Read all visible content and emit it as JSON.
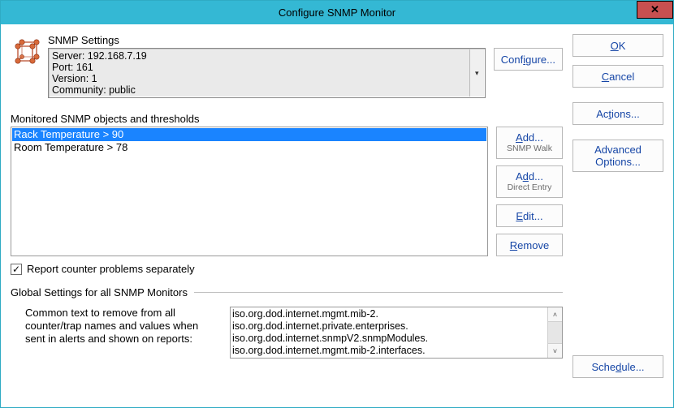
{
  "window": {
    "title": "Configure SNMP Monitor",
    "close_glyph": "✕"
  },
  "snmp": {
    "section_label": "SNMP Settings",
    "server_line": "Server: 192.168.7.19",
    "port_line": "Port: 161",
    "version_line": "Version: 1",
    "community_line": "Community: public",
    "configure_label_pre": "Conf",
    "configure_label_u": "i",
    "configure_label_post": "gure...",
    "dropdown_glyph": "▾"
  },
  "right": {
    "ok_u": "O",
    "ok_post": "K",
    "cancel_u": "C",
    "cancel_post": "ancel",
    "actions_pre": "Ac",
    "actions_u": "t",
    "actions_post": "ions...",
    "advanced_line1": "Advanced",
    "advanced_line2": "Options...",
    "schedule_pre": "Sche",
    "schedule_u": "d",
    "schedule_post": "ule..."
  },
  "monitor": {
    "section_label": "Monitored SNMP objects and thresholds",
    "items": [
      {
        "text": "Rack Temperature > 90",
        "selected": true
      },
      {
        "text": "Room Temperature > 78",
        "selected": false
      }
    ],
    "add_walk_u": "A",
    "add_walk_post": "dd...",
    "add_walk_sub": "SNMP Walk",
    "add_direct_pre": "A",
    "add_direct_u": "d",
    "add_direct_post": "d...",
    "add_direct_sub": "Direct Entry",
    "edit_u": "E",
    "edit_post": "dit...",
    "remove_u": "R",
    "remove_post": "emove"
  },
  "report": {
    "checked_glyph": "✓",
    "label": "Report counter problems separately"
  },
  "global": {
    "header": "Global Settings for all SNMP Monitors",
    "label": "Common text to remove from all counter/trap names and values when sent in alerts and shown on reports:",
    "lines": [
      "iso.org.dod.internet.mgmt.mib-2.",
      "iso.org.dod.internet.private.enterprises.",
      "iso.org.dod.internet.snmpV2.snmpModules.",
      "iso.org.dod.internet.mgmt.mib-2.interfaces."
    ],
    "up_glyph": "˄",
    "down_glyph": "˅"
  }
}
